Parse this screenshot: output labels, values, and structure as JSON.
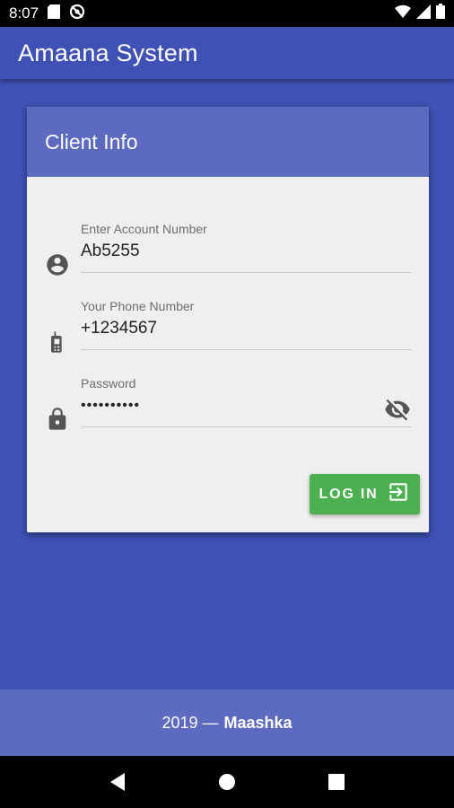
{
  "status_bar": {
    "time": "8:07"
  },
  "app_bar": {
    "title": "Amaana System"
  },
  "card": {
    "title": "Client Info",
    "fields": [
      {
        "label": "Enter Account Number",
        "value": "Ab5255",
        "icon": "account-circle-icon"
      },
      {
        "label": "Your Phone Number",
        "value": "+1234567",
        "icon": "cellphone-icon"
      },
      {
        "label": "Password",
        "value": "••••••••••",
        "icon": "lock-icon"
      }
    ],
    "login_label": "LOG IN"
  },
  "footer": {
    "year_text": "2019 —",
    "brand": "Maashka"
  },
  "colors": {
    "primary": "#3f51b5",
    "card_header": "#5c6bc0",
    "login_button": "#4caf50"
  }
}
